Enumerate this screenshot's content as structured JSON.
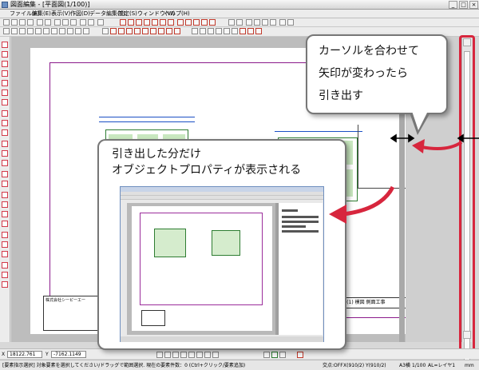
{
  "window": {
    "title": "図面編集 - [平面図(1/100)]",
    "buttons": [
      "_",
      "□",
      "×"
    ]
  },
  "menu": {
    "items": [
      "ファイル(F)",
      "編集(E)",
      "表示(V)",
      "作図(D)",
      "データ編集(T)",
      "設定(S)",
      "ウィンドウ(W)",
      "ヘルプ(H)"
    ]
  },
  "callouts": {
    "cursor": {
      "lines": [
        "カーソルを合わせて",
        "矢印が変わったら",
        "引き出す"
      ]
    },
    "properties": {
      "lines": [
        "引き出した分だけ",
        "オブジェクトプロパティが表示される"
      ]
    }
  },
  "drawing": {
    "company": "株式会社シーピーエー",
    "titleblock_right": "ple(1) 模図 側面工事"
  },
  "status": {
    "x_value": "18122.761",
    "y_value": "-7162.1149",
    "x_label": "X",
    "y_label": "Y",
    "message": "[要素指示選択] 対象要素を選択してください/ドラッグで範囲選択. 現在の要素件数：0 (Ctrl+クリック/要素追加)",
    "cells": [
      "交点:OFF",
      "X(910/2) Y(910/2)",
      "A3横",
      "1/100",
      "AL=レイヤ1",
      "mm"
    ]
  },
  "colors": {
    "callout_border": "#777777",
    "highlight": "#d7263d",
    "arrow": "#d7263d",
    "frame": "#8b1a8b",
    "walls": "#2e7d32"
  },
  "icons": [
    "app-icon",
    "new-icon",
    "open-icon",
    "save-icon",
    "print-icon",
    "undo-icon",
    "redo-icon",
    "zoom-icon",
    "pointer-icon",
    "resize-arrow-icon"
  ]
}
